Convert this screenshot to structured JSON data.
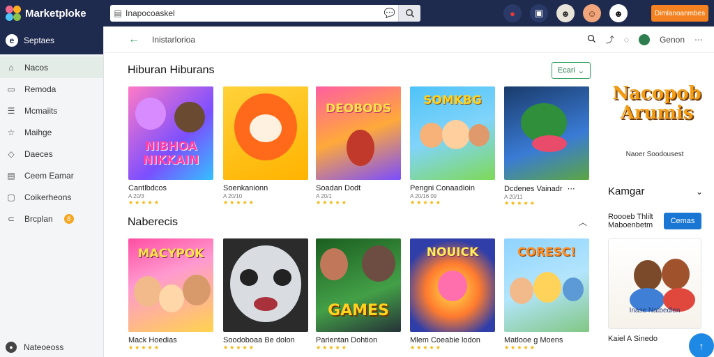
{
  "app": {
    "name": "Marketploke"
  },
  "search": {
    "value": "Inapocoaskel",
    "placeholder": ""
  },
  "topbar": {
    "cta_label": "Dimlanoanmbes"
  },
  "sidebar": {
    "header_label": "Septaes",
    "items": [
      {
        "label": "Nacos",
        "icon": "home-icon"
      },
      {
        "label": "Remoda",
        "icon": "doc-icon"
      },
      {
        "label": "Mcmaiits",
        "icon": "list-icon"
      },
      {
        "label": "Maihge",
        "icon": "star-icon"
      },
      {
        "label": "Daeces",
        "icon": "tag-icon"
      },
      {
        "label": "Ceem Eamar",
        "icon": "calendar-icon"
      },
      {
        "label": "Coikerheons",
        "icon": "gallery-icon"
      },
      {
        "label": "Brcplan",
        "icon": "bag-icon",
        "badge": "8"
      }
    ],
    "footer_label": "Nateoeoss"
  },
  "breadcrumb": {
    "label": "Inistarlorioa"
  },
  "header_actions": {
    "account_label": "Genon"
  },
  "section1": {
    "title": "Hiburan Hiburans",
    "filter_label": "Ecari",
    "games": [
      {
        "title": "Cantlbdcos",
        "meta": "A 20/3",
        "rating": "★★★★★",
        "banner": "NIBHOA NIKKAIN"
      },
      {
        "title": "Soenkanionn",
        "meta": "A 20/10",
        "rating": "★★★★★",
        "banner": ""
      },
      {
        "title": "Soadan Dodt",
        "meta": "A 20/1",
        "rating": "★★★★★",
        "banner": "DEOBODS"
      },
      {
        "title": "Pengni Conaadioin",
        "meta": "A 20/16 09",
        "rating": "★★★★★",
        "banner": "SOMKBG"
      },
      {
        "title": "Dcdenes Vainadr",
        "meta": "A 20/11",
        "rating": "★★★★★",
        "banner": ""
      }
    ]
  },
  "section2": {
    "title": "Naberecis",
    "games": [
      {
        "title": "Mack Hoedias",
        "banner": "MACYPOK"
      },
      {
        "title": "Soodoboaa Be dolon",
        "banner": ""
      },
      {
        "title": "Parientan Dohtion",
        "banner": "GAMES"
      },
      {
        "title": "Mlem Coeabie lodon",
        "banner": "NOUICK"
      },
      {
        "title": "Matlooe g Moens",
        "banner": "CORESC!"
      }
    ]
  },
  "right_panel": {
    "promo_title": "Nacopob Arumis",
    "promo_subtitle": "Naoer Soodousest",
    "kategori_label": "Kamgar",
    "info_text": "Roooeb Thlilt Maboenbetm",
    "button_label": "Cemas",
    "card_caption": "Inase Natbedlen",
    "bottom_title": "Kaiel A Sinedo"
  },
  "colors": {
    "topbar": "#1f2a4f",
    "accent_green": "#2e9e5b",
    "cta_orange": "#f58220",
    "primary_blue": "#1976d2"
  }
}
